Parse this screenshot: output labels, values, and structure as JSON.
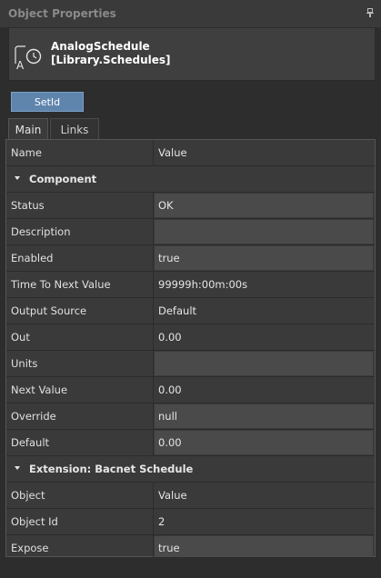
{
  "panel": {
    "title": "Object Properties",
    "pin_icon": "pin-icon"
  },
  "object": {
    "name_line1": "AnalogSchedule",
    "name_line2": "[Library.Schedules]",
    "icon": "analog-schedule-clock-icon"
  },
  "actions": {
    "setid_label": "SetId"
  },
  "tabs": [
    {
      "label": "Main",
      "active": true
    },
    {
      "label": "Links",
      "active": false
    }
  ],
  "grid": {
    "header": {
      "name": "Name",
      "value": "Value"
    },
    "section1": "Component",
    "section2": "Extension: Bacnet Schedule",
    "rows": {
      "status": {
        "label": "Status",
        "value": "OK"
      },
      "description": {
        "label": "Description",
        "value": ""
      },
      "enabled": {
        "label": "Enabled",
        "value": "true"
      },
      "ttnv": {
        "label": "Time To Next Value",
        "value": "99999h:00m:00s"
      },
      "outsrc": {
        "label": "Output Source",
        "value": "Default"
      },
      "out": {
        "label": "Out",
        "value": "0.00"
      },
      "units": {
        "label": "Units",
        "value": ""
      },
      "next": {
        "label": "Next Value",
        "value": "0.00"
      },
      "override": {
        "label": "Override",
        "value": "null"
      },
      "default": {
        "label": "Default",
        "value": "0.00"
      },
      "object": {
        "label": "Object",
        "value": "Value"
      },
      "objid": {
        "label": "Object Id",
        "value": "2"
      },
      "expose": {
        "label": "Expose",
        "value": "true"
      }
    }
  },
  "colors": {
    "button": "#5f85ad",
    "panel_bg": "#2d2d2d",
    "editable_cell": "#4a4a4a"
  }
}
